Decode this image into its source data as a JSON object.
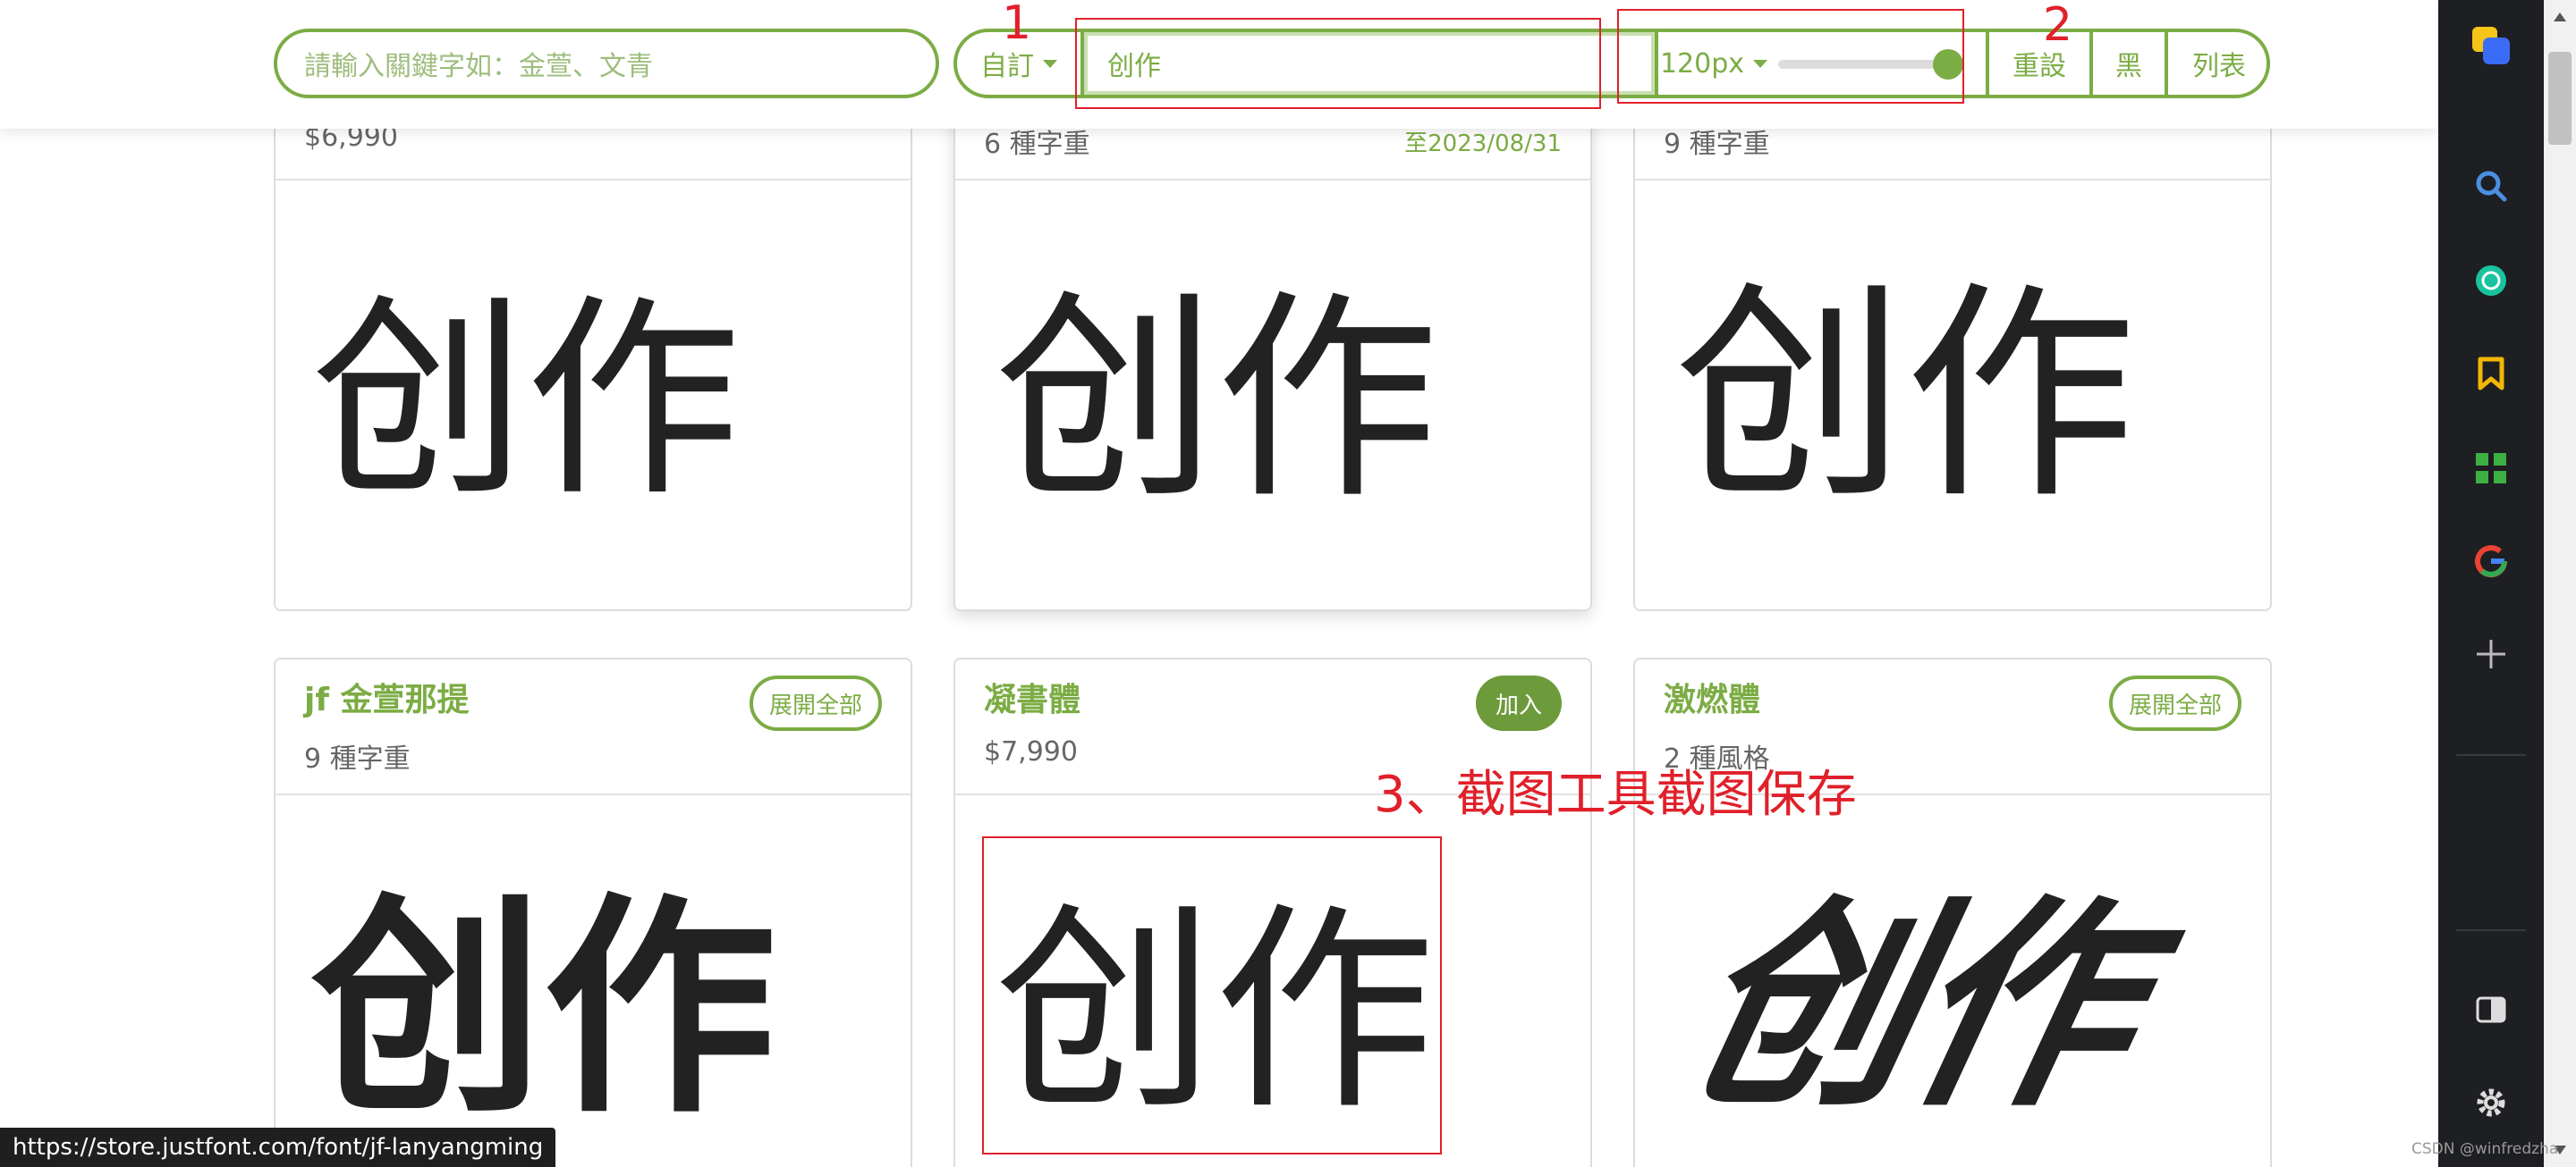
{
  "toolbar": {
    "search_placeholder": "請輸入關鍵字如：金萱、文青",
    "mode_label": "自訂",
    "preview_text": "创作",
    "size_label": "120px",
    "slider_value_fraction": 0.95,
    "reset_label": "重設",
    "dark_label": "黑",
    "list_label": "列表",
    "accent_color": "#7cac44"
  },
  "annotations": {
    "step1": "1",
    "step2": "2",
    "step3": "3、截图工具截图保存"
  },
  "cards_row1": [
    {
      "sub": "$6,990",
      "sample": "创作"
    },
    {
      "sub": "6 種字重",
      "date": "至2023/08/31",
      "sample": "创作"
    },
    {
      "sub": "9 種字重",
      "sample": "创作"
    }
  ],
  "cards_row2": [
    {
      "title": "jf 金萱那提",
      "sub": "9 種字重",
      "button": "展開全部",
      "sample": "创作"
    },
    {
      "title": "凝書體",
      "sub": "$7,990",
      "button": "加入",
      "sample": "创作"
    },
    {
      "title": "激燃體",
      "sub": "2 種風格",
      "button": "展開全部",
      "sample": "创作"
    }
  ],
  "sidebar_icons": [
    "app-logo-icon",
    "search-icon",
    "chatgpt-icon",
    "bookmark-icon",
    "apps-grid-icon",
    "google-icon",
    "plus-icon",
    "split-view-icon",
    "settings-icon"
  ],
  "status_url": "https://store.justfont.com/font/jf-lanyangming",
  "watermark": "CSDN @winfredzha"
}
